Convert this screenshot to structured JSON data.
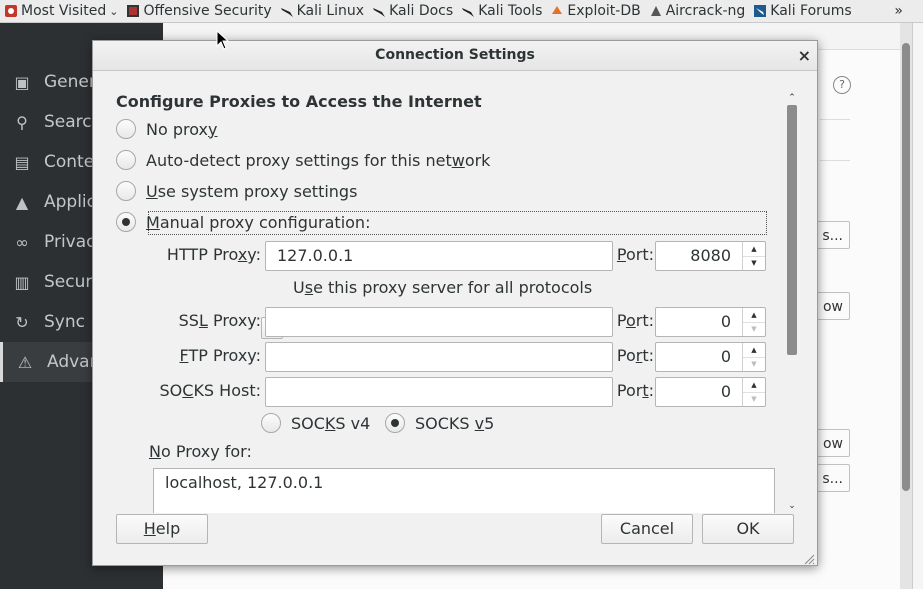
{
  "bookmarks": {
    "items": [
      {
        "label": "Most Visited",
        "icon": "settings-gear-icon",
        "has_dropdown": true
      },
      {
        "label": "Offensive Security",
        "icon": "offsec-icon"
      },
      {
        "label": "Kali Linux",
        "icon": "kali-dragon-icon"
      },
      {
        "label": "Kali Docs",
        "icon": "kali-dragon-icon"
      },
      {
        "label": "Kali Tools",
        "icon": "kali-dragon-icon"
      },
      {
        "label": "Exploit-DB",
        "icon": "exploit-db-icon"
      },
      {
        "label": "Aircrack-ng",
        "icon": "aircrack-icon"
      },
      {
        "label": "Kali Forums",
        "icon": "kali-forums-icon"
      }
    ],
    "more": "»"
  },
  "background_nav": [
    {
      "label": "Gener",
      "icon": "general-icon"
    },
    {
      "label": "Searc",
      "icon": "search-icon"
    },
    {
      "label": "Conte",
      "icon": "content-icon"
    },
    {
      "label": "Applic",
      "icon": "applications-icon"
    },
    {
      "label": "Privac",
      "icon": "privacy-mask-icon"
    },
    {
      "label": "Secur",
      "icon": "security-lock-icon"
    },
    {
      "label": "Sync",
      "icon": "sync-icon"
    },
    {
      "label": "Advan",
      "icon": "advanced-wizard-icon",
      "active": true
    }
  ],
  "background_buttons": {
    "b1": "s...",
    "b2": "ow",
    "b3": "ow",
    "b4": "s..."
  },
  "dialog": {
    "title": "Connection Settings",
    "close": "×",
    "heading": "Configure Proxies to Access the Internet",
    "options": {
      "no_proxy": {
        "pre": "No prox",
        "acc": "y",
        "post": "",
        "checked": false
      },
      "auto_detect": {
        "pre": "Auto-detect proxy settings for this net",
        "acc": "w",
        "post": "ork",
        "checked": false
      },
      "system": {
        "pre": "",
        "acc": "U",
        "post": "se system proxy settings",
        "checked": false
      },
      "manual": {
        "pre": "",
        "acc": "M",
        "post": "anual proxy configuration:",
        "checked": true
      }
    },
    "http": {
      "label_pre": "HTTP Pro",
      "label_acc": "x",
      "label_post": "y:",
      "value": "127.0.0.1",
      "port_pre": "",
      "port_acc": "P",
      "port_post": "ort:",
      "port": "8080"
    },
    "all_protocols": {
      "pre": "U",
      "acc": "s",
      "post": "e this proxy server for all protocols",
      "checked": false
    },
    "ssl": {
      "label_pre": "SS",
      "label_acc": "L",
      "label_post": " Proxy:",
      "value": "",
      "port_pre": "P",
      "port_acc": "o",
      "port_post": "rt:",
      "port": "0"
    },
    "ftp": {
      "label_pre": "",
      "label_acc": "F",
      "label_post": "TP Proxy:",
      "value": "",
      "port_pre": "Po",
      "port_acc": "r",
      "port_post": "t:",
      "port": "0"
    },
    "socks": {
      "label_pre": "SO",
      "label_acc": "C",
      "label_post": "KS Host:",
      "value": "",
      "port_pre": "Por",
      "port_acc": "t",
      "port_post": ":",
      "port": "0"
    },
    "socks_v4": {
      "pre": "SOC",
      "acc": "K",
      "post": "S v4",
      "checked": false
    },
    "socks_v5": {
      "pre": "SOCKS ",
      "acc": "v",
      "post": "5",
      "checked": true
    },
    "no_proxy_for": {
      "pre": "",
      "acc": "N",
      "post": "o Proxy for:",
      "value": "localhost, 127.0.0.1"
    },
    "buttons": {
      "help": {
        "pre": "",
        "acc": "H",
        "post": "elp"
      },
      "cancel": "Cancel",
      "ok": "OK"
    }
  }
}
